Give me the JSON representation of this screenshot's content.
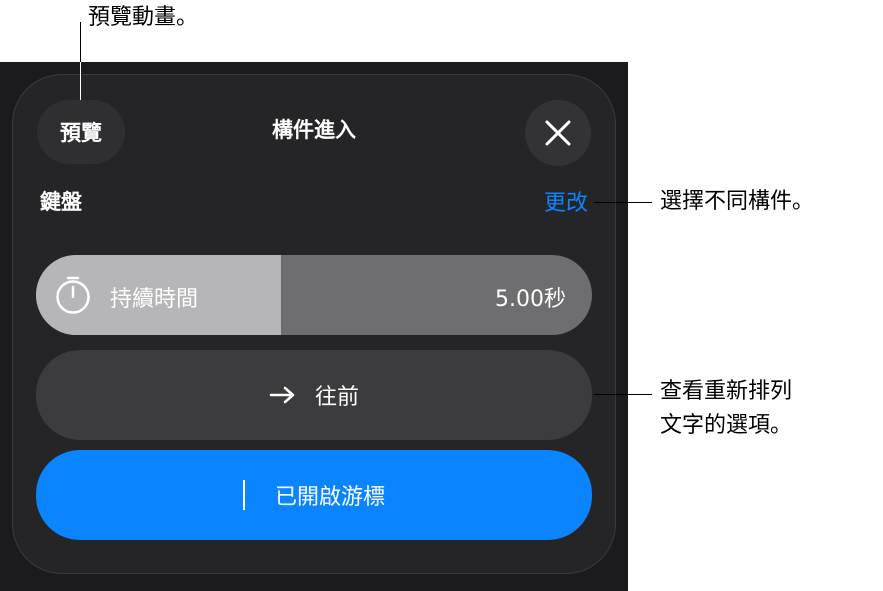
{
  "panel": {
    "preview_label": "預覽",
    "title": "構件進入",
    "section_label": "鍵盤",
    "change_label": "更改",
    "duration": {
      "label": "持續時間",
      "value": "5.00秒",
      "fill_fraction": 0.44
    },
    "direction_label": "往前",
    "cursor_label": "已開啟游標"
  },
  "callouts": {
    "preview": "預覽動畫。",
    "change": "選擇不同構件。",
    "direction_line1": "查看重新排列",
    "direction_line2": "文字的選項。"
  },
  "icons": {
    "close": "close-icon",
    "timer": "timer-icon",
    "arrow": "arrow-right-icon",
    "cursor": "text-cursor-icon"
  },
  "colors": {
    "accent": "#0a84ff",
    "panel": "#252527",
    "background": "#1b1b1d"
  }
}
